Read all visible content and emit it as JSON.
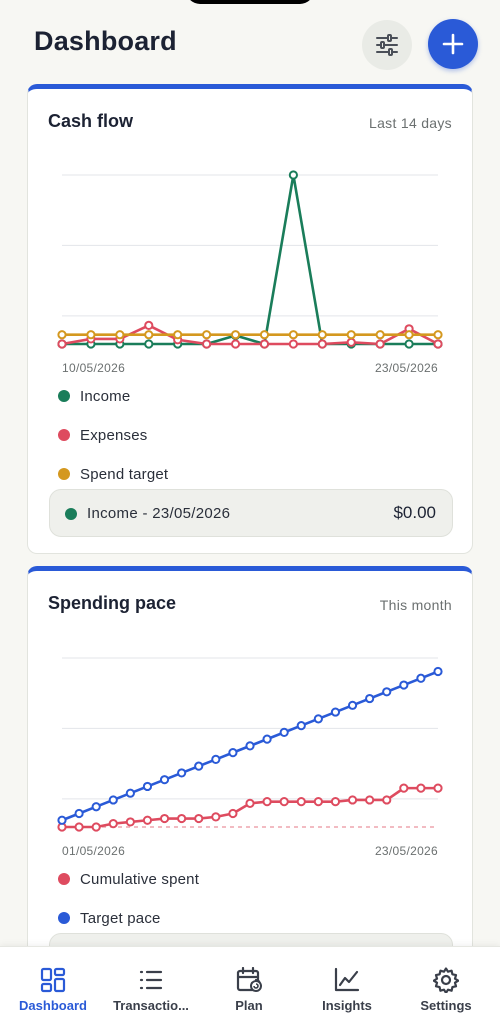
{
  "header": {
    "title": "Dashboard",
    "filter_icon": "sliders-icon",
    "add_icon": "plus-icon"
  },
  "colors": {
    "accent": "#2a5ad7",
    "income": "#1a7d5a",
    "expenses": "#de4b5f",
    "spend_target": "#d4981f",
    "target_pace": "#2a5ad7",
    "cumulative_spent": "#de4b5f"
  },
  "cash_flow": {
    "title": "Cash flow",
    "range": "Last 14 days",
    "x_start_label": "10/05/2026",
    "x_end_label": "23/05/2026",
    "legend": [
      {
        "label": "Income",
        "color": "#1a7d5a"
      },
      {
        "label": "Expenses",
        "color": "#de4b5f"
      },
      {
        "label": "Spend target",
        "color": "#d4981f"
      }
    ],
    "tooltip": {
      "label": "Income - 23/05/2026",
      "value": "$0.00"
    }
  },
  "spending_pace": {
    "title": "Spending pace",
    "range": "This month",
    "x_start_label": "01/05/2026",
    "x_end_label": "23/05/2026",
    "legend": [
      {
        "label": "Cumulative spent",
        "color": "#de4b5f"
      },
      {
        "label": "Target pace",
        "color": "#2a5ad7"
      }
    ]
  },
  "chart_data": [
    {
      "type": "line",
      "title": "Cash flow",
      "x": [
        "10/05/2026",
        "11/05/2026",
        "12/05/2026",
        "13/05/2026",
        "14/05/2026",
        "15/05/2026",
        "16/05/2026",
        "17/05/2026",
        "18/05/2026",
        "19/05/2026",
        "20/05/2026",
        "21/05/2026",
        "22/05/2026",
        "23/05/2026"
      ],
      "ylim": [
        0,
        200
      ],
      "grid": true,
      "legend_placement": "bottom",
      "series": [
        {
          "name": "Income",
          "color": "#1a7d5a",
          "values": [
            0,
            0,
            0,
            0,
            0,
            0,
            10,
            0,
            200,
            0,
            0,
            0,
            0,
            0
          ]
        },
        {
          "name": "Expenses",
          "color": "#de4b5f",
          "values": [
            0,
            6,
            6,
            22,
            5,
            0,
            0,
            0,
            0,
            0,
            2,
            0,
            18,
            0
          ]
        },
        {
          "name": "Spend target",
          "color": "#d4981f",
          "values": [
            11,
            11,
            11,
            11,
            11,
            11,
            11,
            11,
            11,
            11,
            11,
            11,
            11,
            11
          ]
        }
      ]
    },
    {
      "type": "line",
      "title": "Spending pace",
      "x": [
        "01/05/2026",
        "02/05/2026",
        "03/05/2026",
        "04/05/2026",
        "05/05/2026",
        "06/05/2026",
        "07/05/2026",
        "08/05/2026",
        "09/05/2026",
        "10/05/2026",
        "11/05/2026",
        "12/05/2026",
        "13/05/2026",
        "14/05/2026",
        "15/05/2026",
        "16/05/2026",
        "17/05/2026",
        "18/05/2026",
        "19/05/2026",
        "20/05/2026",
        "21/05/2026",
        "22/05/2026",
        "23/05/2026"
      ],
      "ylim": [
        0,
        100
      ],
      "grid": true,
      "legend_placement": "bottom",
      "series": [
        {
          "name": "Cumulative spent",
          "color": "#de4b5f",
          "values": [
            0,
            0,
            0,
            2,
            3,
            4,
            5,
            5,
            5,
            6,
            8,
            14,
            15,
            15,
            15,
            15,
            15,
            16,
            16,
            16,
            23,
            23,
            23
          ]
        },
        {
          "name": "Target pace",
          "color": "#2a5ad7",
          "values": [
            4,
            8,
            12,
            16,
            20,
            24,
            28,
            32,
            36,
            40,
            44,
            48,
            52,
            56,
            60,
            64,
            68,
            72,
            76,
            80,
            84,
            88,
            92
          ]
        }
      ]
    }
  ],
  "nav": {
    "items": [
      {
        "label": "Dashboard",
        "icon": "dashboard-icon",
        "active": true
      },
      {
        "label": "Transactio...",
        "icon": "list-icon",
        "active": false
      },
      {
        "label": "Plan",
        "icon": "calendar-icon",
        "active": false
      },
      {
        "label": "Insights",
        "icon": "chart-icon",
        "active": false
      },
      {
        "label": "Settings",
        "icon": "gear-icon",
        "active": false
      }
    ]
  }
}
